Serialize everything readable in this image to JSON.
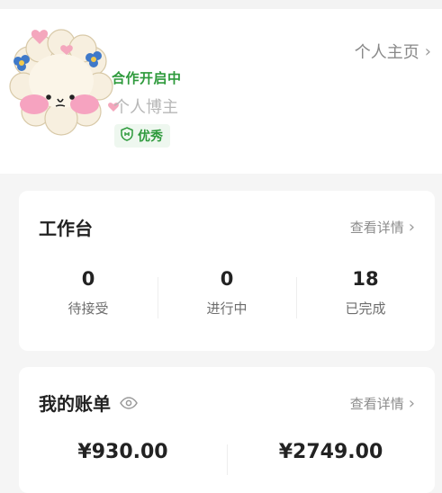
{
  "profile": {
    "coop_status": "合作开启中",
    "role": "个人博主",
    "level_tag": "优秀",
    "homepage_link": "个人主页",
    "avatar_icon": "avatar-sheep-icon",
    "shield_icon": "shield-icon"
  },
  "workbench": {
    "title": "工作台",
    "detail_link": "查看详情",
    "stats": [
      {
        "value": "0",
        "label": "待接受"
      },
      {
        "value": "0",
        "label": "进行中"
      },
      {
        "value": "18",
        "label": "已完成"
      }
    ]
  },
  "bill": {
    "title": "我的账单",
    "detail_link": "查看详情",
    "amounts": [
      "¥930.00",
      "¥2749.00"
    ]
  },
  "colors": {
    "accent_green": "#2e9a3c",
    "card_bg": "#ffffff",
    "page_bg": "#f5f5f5"
  }
}
